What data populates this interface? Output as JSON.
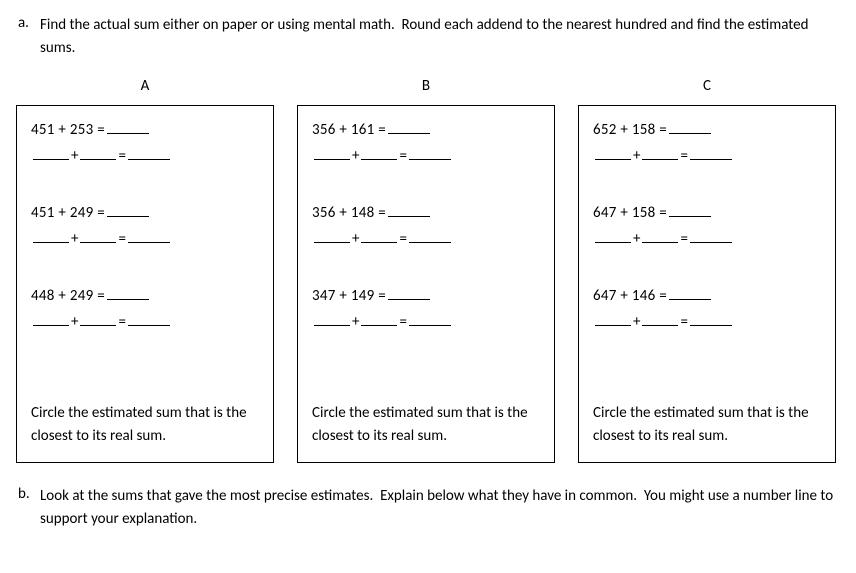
{
  "question_a": {
    "letter": "a.",
    "text": "Find the actual sum either on paper or using mental math.  Round each addend to the nearest hundred and find the estimated sums."
  },
  "columns": [
    {
      "label": "A",
      "problems": [
        {
          "expr": "451  +  253  ="
        },
        {
          "expr": "451  + 249  ="
        },
        {
          "expr": "448  +  249  ="
        }
      ],
      "circle_text": "Circle the estimated sum that is the closest to its real sum."
    },
    {
      "label": "B",
      "problems": [
        {
          "expr": "356  + 161   ="
        },
        {
          "expr": "356  + 148  ="
        },
        {
          "expr": "347  + 149   ="
        }
      ],
      "circle_text": "Circle the estimated sum that is the closest to its real sum."
    },
    {
      "label": "C",
      "problems": [
        {
          "expr": "652  + 158  ="
        },
        {
          "expr": "647  + 158  ="
        },
        {
          "expr": "647  +  146  ="
        }
      ],
      "circle_text": "Circle the estimated sum that is the closest to its real sum."
    }
  ],
  "question_b": {
    "letter": "b.",
    "text": "Look at the sums that gave the most precise estimates.  Explain below what they have in common.  You might use a number line to support your explanation."
  },
  "labels": {
    "plus": "+",
    "equals": "="
  }
}
